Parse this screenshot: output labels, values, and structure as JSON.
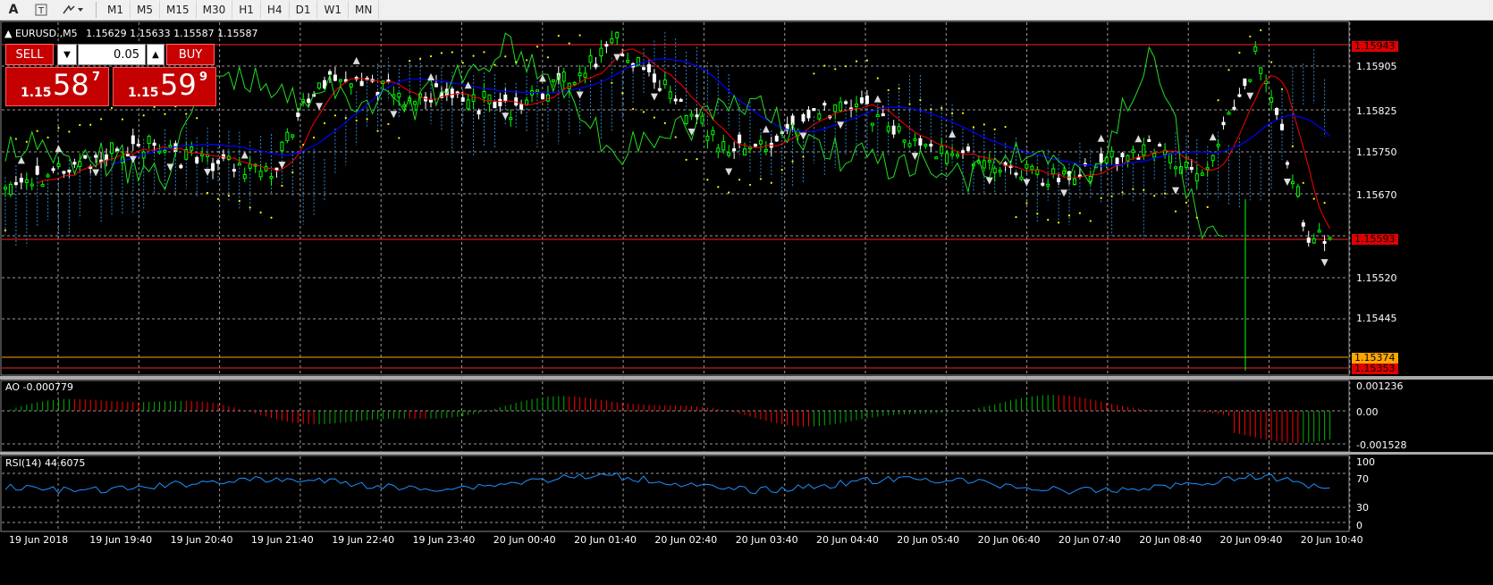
{
  "toolbar": {
    "text_tool": "A",
    "timeframes": [
      "M1",
      "M5",
      "M15",
      "M30",
      "H1",
      "H4",
      "D1",
      "W1",
      "MN"
    ]
  },
  "chart": {
    "symbol": "EURUSD.,M5",
    "ohlc": "1.15629 1.15633 1.15587 1.15587",
    "price_axis": [
      "1.15905",
      "1.15825",
      "1.15750",
      "1.15670",
      "1.15520",
      "1.15445"
    ],
    "price_tags": {
      "high_line": "1.15943",
      "bid_line": "1.15593",
      "orange_line": "1.15374",
      "low_line": "1.15353"
    },
    "time_axis": [
      "19 Jun 2018",
      "19 Jun 19:40",
      "19 Jun 20:40",
      "19 Jun 21:40",
      "19 Jun 22:40",
      "19 Jun 23:40",
      "20 Jun 00:40",
      "20 Jun 01:40",
      "20 Jun 02:40",
      "20 Jun 03:40",
      "20 Jun 04:40",
      "20 Jun 05:40",
      "20 Jun 06:40",
      "20 Jun 07:40",
      "20 Jun 08:40",
      "20 Jun 09:40",
      "20 Jun 10:40"
    ],
    "colors": {
      "bull": "#00ff00",
      "bear": "#ffffff",
      "grid": "#9a9a9a",
      "ma_red": "#ff0000",
      "ma_blue": "#0000ff",
      "ao_up": "#00b000",
      "ao_down": "#ff0000",
      "rsi": "#1e90ff"
    }
  },
  "trade_panel": {
    "sell_label": "SELL",
    "buy_label": "BUY",
    "lot": "0.05",
    "sell_price_small": "1.15",
    "sell_price_big": "58",
    "sell_price_sup": "7",
    "buy_price_small": "1.15",
    "buy_price_big": "59",
    "buy_price_sup": "9"
  },
  "ao": {
    "label": "AO -0.000779",
    "axis": [
      "0.001236",
      "0.00",
      "-0.001528"
    ]
  },
  "rsi": {
    "label": "RSI(14) 44.6075",
    "axis": [
      "100",
      "70",
      "30",
      "0"
    ]
  }
}
